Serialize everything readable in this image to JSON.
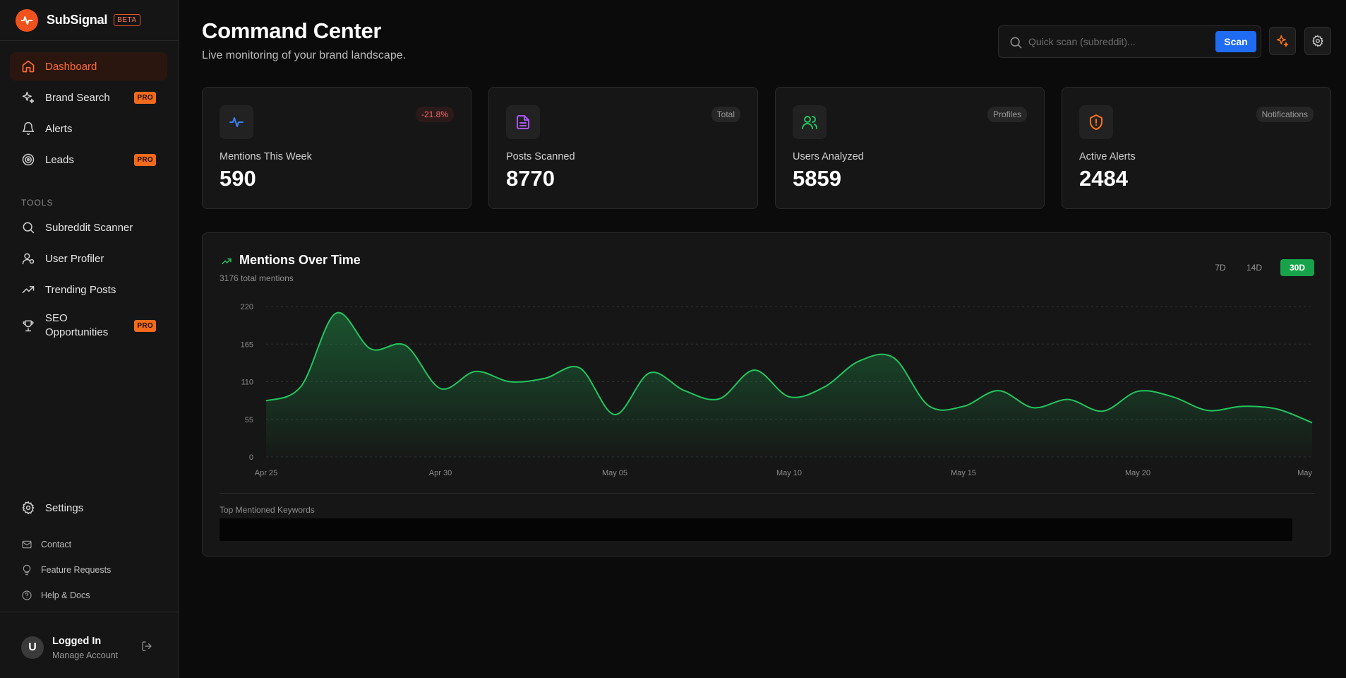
{
  "brand": {
    "name": "SubSignal",
    "badge": "BETA",
    "accent": "#f0521d"
  },
  "nav": {
    "items": [
      {
        "label": "Dashboard",
        "icon": "home-icon",
        "active": true
      },
      {
        "label": "Brand Search",
        "icon": "sparkles-icon",
        "badge": "PRO"
      },
      {
        "label": "Alerts",
        "icon": "bell-icon"
      },
      {
        "label": "Leads",
        "icon": "target-icon",
        "badge": "PRO"
      }
    ],
    "tools_heading": "TOOLS",
    "tools": [
      {
        "label": "Subreddit Scanner",
        "icon": "search-icon"
      },
      {
        "label": "User Profiler",
        "icon": "user-icon"
      },
      {
        "label": "Trending Posts",
        "icon": "trending-up-icon"
      },
      {
        "label_line1": "SEO",
        "label_line2": "Opportunities",
        "icon": "trophy-icon",
        "badge": "PRO"
      }
    ],
    "settings": "Settings",
    "footer_links": [
      "Contact",
      "Feature Requests",
      "Help & Docs"
    ]
  },
  "user": {
    "initial": "U",
    "name": "Logged In",
    "sub": "Manage Account"
  },
  "header": {
    "title": "Command Center",
    "subtitle": "Live monitoring of your brand landscape.",
    "search_placeholder": "Quick scan (subreddit)...",
    "scan_label": "Scan"
  },
  "stats": [
    {
      "label": "Mentions This Week",
      "value": "590",
      "badge": "-21.8%",
      "icon": "activity-icon",
      "color": "#3b82f6"
    },
    {
      "label": "Posts Scanned",
      "value": "8770",
      "badge": "Total",
      "icon": "file-text-icon",
      "color": "#a855f7"
    },
    {
      "label": "Users Analyzed",
      "value": "5859",
      "badge": "Profiles",
      "icon": "users-icon",
      "color": "#22c55e"
    },
    {
      "label": "Active Alerts",
      "value": "2484",
      "badge": "Notifications",
      "icon": "shield-alert-icon",
      "color": "#f97316"
    }
  ],
  "chart_panel": {
    "title": "Mentions Over Time",
    "subtitle": "3176 total mentions",
    "ranges": [
      "7D",
      "14D",
      "30D"
    ],
    "active_range": "30D",
    "keywords_label": "Top Mentioned Keywords"
  },
  "chart_data": {
    "type": "area",
    "x": [
      "Apr 25",
      "Apr 26",
      "Apr 27",
      "Apr 28",
      "Apr 29",
      "Apr 30",
      "May 01",
      "May 02",
      "May 03",
      "May 04",
      "May 05",
      "May 06",
      "May 07",
      "May 08",
      "May 09",
      "May 10",
      "May 11",
      "May 12",
      "May 13",
      "May 14",
      "May 15",
      "May 16",
      "May 17",
      "May 18",
      "May 19",
      "May 20",
      "May 21",
      "May 22",
      "May 23",
      "May 24",
      "May 25"
    ],
    "values": [
      82,
      103,
      210,
      158,
      163,
      100,
      125,
      110,
      115,
      130,
      62,
      123,
      97,
      85,
      127,
      88,
      102,
      140,
      145,
      75,
      74,
      97,
      72,
      84,
      67,
      96,
      88,
      68,
      74,
      70,
      50
    ],
    "x_tick_labels": [
      "Apr 25",
      "Apr 30",
      "May 05",
      "May 10",
      "May 15",
      "May 20",
      "May"
    ],
    "y_ticks": [
      0,
      55,
      110,
      165,
      220
    ],
    "ylim": [
      0,
      220
    ],
    "grid": true,
    "line_color": "#22c55e"
  }
}
